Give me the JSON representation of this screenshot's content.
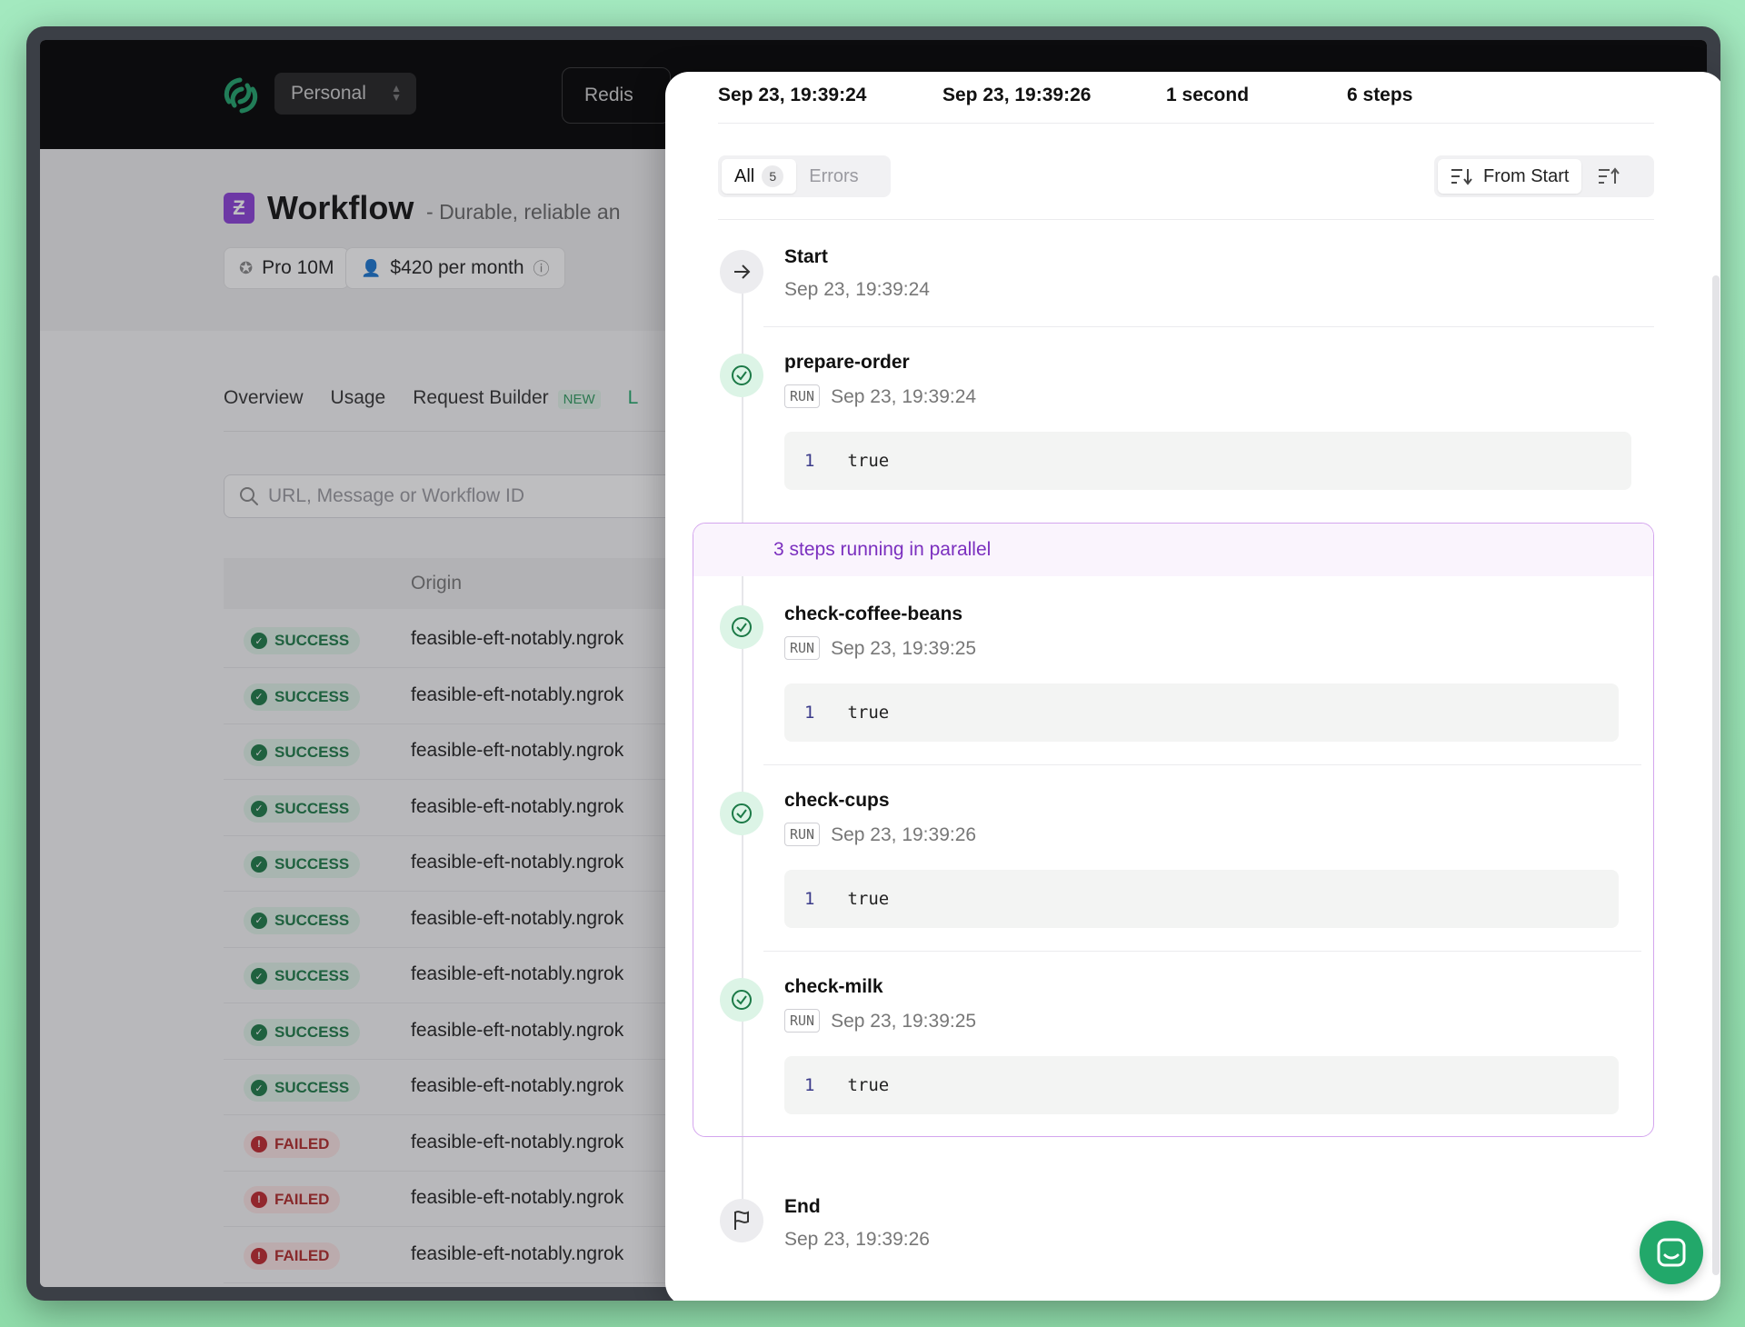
{
  "app": {
    "team": "Personal",
    "database": "Redis",
    "product": {
      "title": "Workflow",
      "subtitle": "Durable, reliable an"
    },
    "plan": "Pro 10M",
    "price": "$420 per month",
    "tabs": [
      {
        "label": "Overview"
      },
      {
        "label": "Usage"
      },
      {
        "label": "Request Builder",
        "badge": "NEW"
      },
      {
        "label": "L"
      }
    ],
    "search": {
      "placeholder": "URL, Message or Workflow ID"
    },
    "table": {
      "origin_header": "Origin",
      "rows": [
        {
          "status": "SUCCESS",
          "origin": "feasible-eft-notably.ngrok"
        },
        {
          "status": "SUCCESS",
          "origin": "feasible-eft-notably.ngrok"
        },
        {
          "status": "SUCCESS",
          "origin": "feasible-eft-notably.ngrok"
        },
        {
          "status": "SUCCESS",
          "origin": "feasible-eft-notably.ngrok"
        },
        {
          "status": "SUCCESS",
          "origin": "feasible-eft-notably.ngrok"
        },
        {
          "status": "SUCCESS",
          "origin": "feasible-eft-notably.ngrok"
        },
        {
          "status": "SUCCESS",
          "origin": "feasible-eft-notably.ngrok"
        },
        {
          "status": "SUCCESS",
          "origin": "feasible-eft-notably.ngrok"
        },
        {
          "status": "SUCCESS",
          "origin": "feasible-eft-notably.ngrok"
        },
        {
          "status": "FAILED",
          "origin": "feasible-eft-notably.ngrok"
        },
        {
          "status": "FAILED",
          "origin": "feasible-eft-notably.ngrok"
        },
        {
          "status": "FAILED",
          "origin": "feasible-eft-notably.ngrok"
        }
      ]
    }
  },
  "drawer": {
    "stats": [
      {
        "value": "Sep 23, 19:39:24"
      },
      {
        "value": "Sep 23, 19:39:26"
      },
      {
        "value": "1 second"
      },
      {
        "value": "6 steps"
      }
    ],
    "filter": {
      "all_label": "All",
      "all_count": "5",
      "errors_label": "Errors"
    },
    "sort": {
      "label": "From Start"
    },
    "start": {
      "name": "Start",
      "time": "Sep 23, 19:39:24"
    },
    "steps": [
      {
        "name": "prepare-order",
        "tag": "RUN",
        "time": "Sep 23, 19:39:24",
        "line": "1",
        "output": "true"
      }
    ],
    "parallel": {
      "label": "3 steps running in parallel",
      "steps": [
        {
          "name": "check-coffee-beans",
          "tag": "RUN",
          "time": "Sep 23, 19:39:25",
          "line": "1",
          "output": "true"
        },
        {
          "name": "check-cups",
          "tag": "RUN",
          "time": "Sep 23, 19:39:26",
          "line": "1",
          "output": "true"
        },
        {
          "name": "check-milk",
          "tag": "RUN",
          "time": "Sep 23, 19:39:25",
          "line": "1",
          "output": "true"
        }
      ]
    },
    "end": {
      "name": "End",
      "time": "Sep 23, 19:39:26"
    }
  },
  "colors": {
    "accent": "#22a86a",
    "parallel": "#7b2fbf",
    "brand": "#8b3fd9"
  }
}
